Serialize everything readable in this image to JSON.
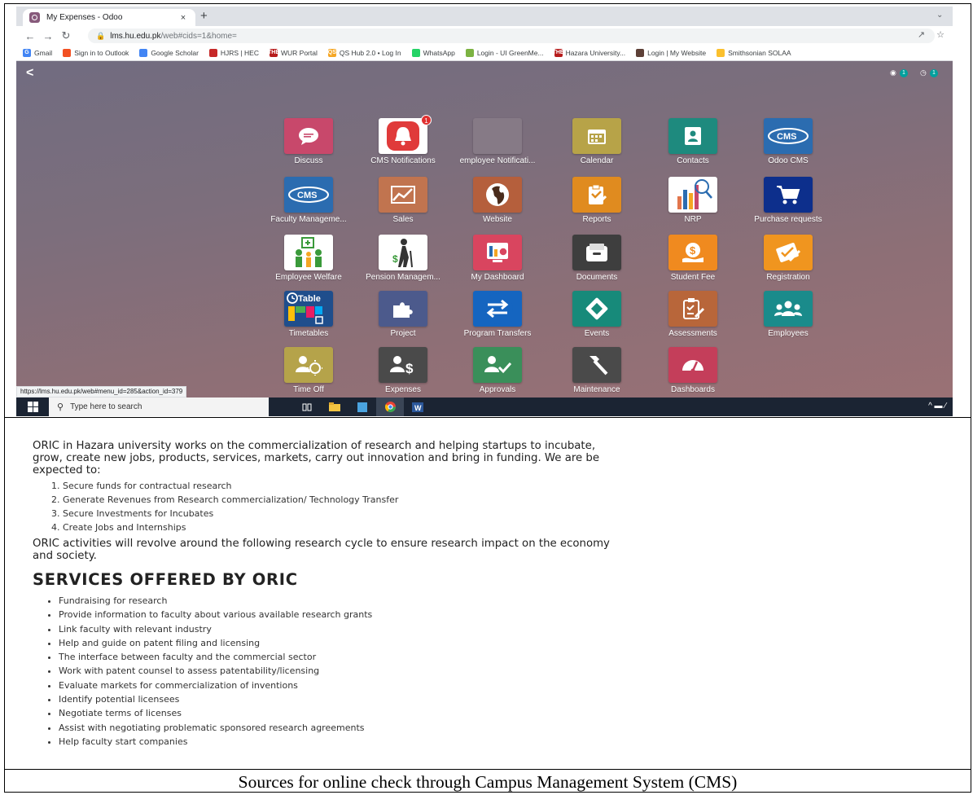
{
  "browser": {
    "tab_title": "My Expenses - Odoo",
    "close_glyph": "×",
    "new_tab_glyph": "+",
    "url_host": "lms.hu.edu.pk",
    "url_path": "/web#cids=1&home=",
    "bookmarks": [
      {
        "label": "Gmail",
        "icon_text": "G",
        "color": "#4285f4"
      },
      {
        "label": "Sign in to Outlook",
        "icon_text": "",
        "color": "#f25022"
      },
      {
        "label": "Google Scholar",
        "icon_text": "",
        "color": "#4285f4"
      },
      {
        "label": "HJRS | HEC",
        "icon_text": "",
        "color": "#c62828"
      },
      {
        "label": "WUR Portal",
        "icon_text": "THE",
        "color": "#b71c1c"
      },
      {
        "label": "QS Hub 2.0 • Log In",
        "icon_text": "QS",
        "color": "#f5a623"
      },
      {
        "label": "WhatsApp",
        "icon_text": "",
        "color": "#25d366"
      },
      {
        "label": "Login - UI GreenMe...",
        "icon_text": "",
        "color": "#7cb342"
      },
      {
        "label": "Hazara University...",
        "icon_text": "THE",
        "color": "#b71c1c"
      },
      {
        "label": "Login | My Website",
        "icon_text": "",
        "color": "#5d4037"
      },
      {
        "label": "Smithsonian SOLAA",
        "icon_text": "",
        "color": "#fbc02d"
      }
    ],
    "status_url": "https://lms.hu.edu.pk/web#menu_id=285&action_id=379"
  },
  "odoo": {
    "back_glyph": "<",
    "chat_badge": "1",
    "activity_badge": "1",
    "apps": [
      {
        "label": "Discuss",
        "icon": "discuss-icon",
        "color": "#c8486b",
        "badge": ""
      },
      {
        "label": "CMS Notifications",
        "icon": "bell-icon",
        "color": "#ffffff",
        "badge": "1"
      },
      {
        "label": "employee Notificati...",
        "icon": "blank-icon",
        "color": "#867a86",
        "badge": ""
      },
      {
        "label": "Calendar",
        "icon": "calendar-icon",
        "color": "#b7a348",
        "badge": ""
      },
      {
        "label": "Contacts",
        "icon": "contacts-icon",
        "color": "#1e8a7e",
        "badge": ""
      },
      {
        "label": "Odoo CMS",
        "icon": "cms-icon",
        "color": "#2b6cb0",
        "badge": ""
      },
      {
        "label": "Faculty Manageme...",
        "icon": "cms-icon",
        "color": "#2b6cb0",
        "badge": ""
      },
      {
        "label": "Sales",
        "icon": "sales-chart-icon",
        "color": "#c1744f",
        "badge": ""
      },
      {
        "label": "Website",
        "icon": "globe-icon",
        "color": "#b55f3c",
        "badge": ""
      },
      {
        "label": "Reports",
        "icon": "reports-icon",
        "color": "#e08b1f",
        "badge": ""
      },
      {
        "label": "NRP",
        "icon": "nrp-chart-icon",
        "color": "#ffffff",
        "badge": ""
      },
      {
        "label": "Purchase requests",
        "icon": "cart-icon",
        "color": "#0d2f8c",
        "badge": ""
      },
      {
        "label": "Employee Welfare",
        "icon": "welfare-icon",
        "color": "#ffffff",
        "badge": ""
      },
      {
        "label": "Pension Managem...",
        "icon": "pension-icon",
        "color": "#ffffff",
        "badge": ""
      },
      {
        "label": "My Dashboard",
        "icon": "dashboard-icon",
        "color": "#d9455f",
        "badge": ""
      },
      {
        "label": "Documents",
        "icon": "documents-icon",
        "color": "#3e3e3e",
        "badge": ""
      },
      {
        "label": "Student Fee",
        "icon": "fee-icon",
        "color": "#f08a1f",
        "badge": ""
      },
      {
        "label": "Registration",
        "icon": "registration-icon",
        "color": "#f0951f",
        "badge": ""
      },
      {
        "label": "Timetables",
        "icon": "timetable-icon",
        "color": "#1f4e8c",
        "badge": ""
      },
      {
        "label": "Project",
        "icon": "puzzle-icon",
        "color": "#4c5a8c",
        "badge": ""
      },
      {
        "label": "Program Transfers",
        "icon": "transfer-icon",
        "color": "#1565c0",
        "badge": ""
      },
      {
        "label": "Events",
        "icon": "ticket-icon",
        "color": "#178a7a",
        "badge": ""
      },
      {
        "label": "Assessments",
        "icon": "assessment-icon",
        "color": "#b8663a",
        "badge": ""
      },
      {
        "label": "Employees",
        "icon": "employees-icon",
        "color": "#1a8b8b",
        "badge": ""
      },
      {
        "label": "Time Off",
        "icon": "timeoff-icon",
        "color": "#b5a34a",
        "badge": ""
      },
      {
        "label": "Expenses",
        "icon": "expenses-icon",
        "color": "#4a4a4a",
        "badge": ""
      },
      {
        "label": "Approvals",
        "icon": "approvals-icon",
        "color": "#3a8f5a",
        "badge": ""
      },
      {
        "label": "Maintenance",
        "icon": "hammer-icon",
        "color": "#4a4a4a",
        "badge": ""
      },
      {
        "label": "Dashboards",
        "icon": "gauge-icon",
        "color": "#c43e5a",
        "badge": ""
      }
    ]
  },
  "taskbar": {
    "search_placeholder": "Type here to search"
  },
  "document": {
    "intro": "ORIC in Hazara university works on the commercialization of research and helping startups to incubate, grow, create new jobs, products, services, markets, carry out innovation and bring in funding. We are be expected to:",
    "expectations": [
      "Secure funds for contractual research",
      "Generate Revenues from Research commercialization/ Technology Transfer",
      "Secure Investments for Incubates",
      "Create Jobs and Internships"
    ],
    "cycle": "ORIC activities will revolve around the following research cycle to ensure research impact on the economy and society.",
    "services_heading": "SERVICES OFFERED BY ORIC",
    "services": [
      "Fundraising for research",
      "Provide information to faculty about various available research grants",
      "Link faculty with relevant industry",
      "Help and guide on patent filing and licensing",
      "The interface between faculty and the commercial sector",
      "Work with patent counsel to assess patentability/licensing",
      "Evaluate markets for commercialization of inventions",
      "Identify potential licensees",
      "Negotiate terms of licenses",
      "Assist with negotiating problematic sponsored research agreements",
      "Help faculty start companies"
    ]
  },
  "caption": "Sources for online check through Campus Management System (CMS)"
}
